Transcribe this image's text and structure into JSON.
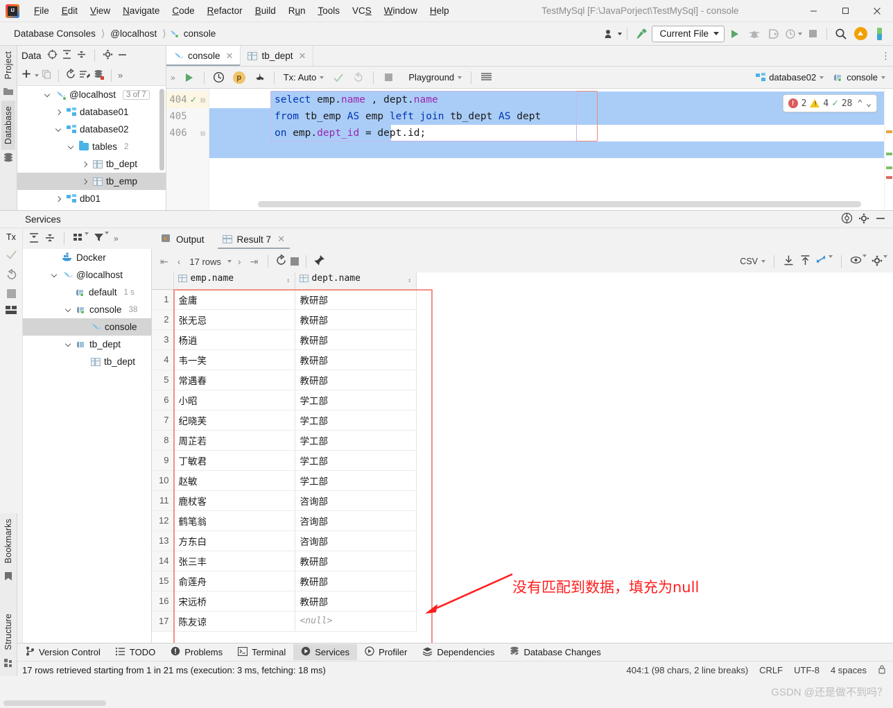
{
  "window": {
    "title": "TestMySql [F:\\JavaPorject\\TestMySql] - console",
    "logo_icon": "intellij-idea-logo",
    "minimize_label": "—",
    "maximize_label": "☐",
    "close_label": "✕"
  },
  "menu": [
    {
      "label": "File",
      "mnemonic": "F"
    },
    {
      "label": "Edit",
      "mnemonic": "E"
    },
    {
      "label": "View",
      "mnemonic": "V"
    },
    {
      "label": "Navigate",
      "mnemonic": "N"
    },
    {
      "label": "Code",
      "mnemonic": "C"
    },
    {
      "label": "Refactor",
      "mnemonic": "R"
    },
    {
      "label": "Build",
      "mnemonic": "B"
    },
    {
      "label": "Run",
      "mnemonic": "u"
    },
    {
      "label": "Tools",
      "mnemonic": "T"
    },
    {
      "label": "VCS",
      "mnemonic": "S"
    },
    {
      "label": "Window",
      "mnemonic": "W"
    },
    {
      "label": "Help",
      "mnemonic": "H"
    }
  ],
  "breadcrumb": {
    "items": [
      "Database Consoles",
      "@localhost",
      "console"
    ],
    "console_icon": "dolphin-icon"
  },
  "navbar": {
    "run_config": "Current File",
    "icons": [
      "settings-sync-icon",
      "build-hammer-icon",
      "run-icon",
      "debug-icon",
      "run-coverage-icon",
      "profile-icon",
      "stop-icon",
      "search-everywhere-icon",
      "update-project-icon"
    ]
  },
  "left_strip": {
    "tabs": [
      "Project",
      "Database",
      "Bookmarks",
      "Structure"
    ]
  },
  "database_panel": {
    "title": "Data",
    "header_icons": [
      "locate-icon",
      "expand-all-icon",
      "collapse-all-icon",
      "settings-icon",
      "hide-icon"
    ],
    "toolbar_icons": [
      "add-icon",
      "copy-icon",
      "refresh-icon",
      "sql-script-icon",
      "db-properties-icon",
      "more-icon"
    ],
    "tree": [
      {
        "label": "@localhost",
        "badge": "3 of 7",
        "icon": "dolphin-icon",
        "expanded": true,
        "indent": 0
      },
      {
        "label": "database01",
        "icon": "schema-icon",
        "expanded": false,
        "indent": 1
      },
      {
        "label": "database02",
        "icon": "schema-icon",
        "expanded": true,
        "indent": 1
      },
      {
        "label": "tables",
        "count": "2",
        "icon": "folder-icon",
        "expanded": true,
        "indent": 2
      },
      {
        "label": "tb_dept",
        "icon": "table-icon",
        "expanded": false,
        "indent": 3
      },
      {
        "label": "tb_emp",
        "icon": "table-icon",
        "expanded": false,
        "indent": 3,
        "selected": true
      },
      {
        "label": "db01",
        "icon": "schema-icon",
        "expanded": false,
        "indent": 1
      }
    ]
  },
  "editor": {
    "tabs": [
      {
        "label": "console",
        "icon": "dolphin-icon",
        "active": true,
        "close": "✕"
      },
      {
        "label": "tb_dept",
        "icon": "table-icon",
        "active": false,
        "close": "✕"
      }
    ],
    "toolbar": {
      "tx_label": "Tx: Auto",
      "schema_label": "Playground",
      "icons": [
        "execute-icon",
        "history-icon",
        "parameters-icon",
        "wrench-icon",
        "commit-icon",
        "rollback-icon",
        "stop-icon",
        "table-mode-icon"
      ]
    },
    "source": {
      "datasource": "database02",
      "datasource_icon": "schema-icon",
      "session": "console",
      "session_icon": "session-icon"
    },
    "lines": [
      {
        "number": "404",
        "gutter_icon": "check-green",
        "tokens": [
          {
            "t": "select ",
            "c": "kw"
          },
          {
            "t": "emp.",
            "c": "pl"
          },
          {
            "t": "name",
            "c": "prop"
          },
          {
            "t": " , dept.",
            "c": "pl"
          },
          {
            "t": "name",
            "c": "prop"
          }
        ]
      },
      {
        "number": "405",
        "tokens": [
          {
            "t": "from ",
            "c": "kw"
          },
          {
            "t": "tb_emp ",
            "c": "pl"
          },
          {
            "t": "AS ",
            "c": "kw"
          },
          {
            "t": "emp ",
            "c": "pl"
          },
          {
            "t": "left join ",
            "c": "kw"
          },
          {
            "t": "tb_dept ",
            "c": "pl"
          },
          {
            "t": "AS ",
            "c": "kw"
          },
          {
            "t": "dept",
            "c": "pl"
          }
        ]
      },
      {
        "number": "406",
        "tokens": [
          {
            "t": "on ",
            "c": "kw"
          },
          {
            "t": "emp.",
            "c": "pl"
          },
          {
            "t": "dept_id",
            "c": "prop"
          },
          {
            "t": " = dept.",
            "c": "pl"
          },
          {
            "t": "id;",
            "c": "pl"
          }
        ]
      }
    ],
    "plain_lines": [
      "select emp.name , dept.name",
      "from tb_emp AS emp left join tb_dept AS dept",
      "on emp.dept_id = dept.id;"
    ],
    "inspection": {
      "errors": "2",
      "warnings": "4",
      "typos": "28",
      "up_label": "⌃",
      "down_label": "⌄"
    }
  },
  "services": {
    "title": "Services",
    "header_icons": [
      "help-icon",
      "settings-icon",
      "hide-icon"
    ],
    "vtool": {
      "label": "Tx",
      "icons": [
        "commit-icon",
        "rollback-icon",
        "stop-icon",
        "layout-icon"
      ]
    },
    "tree_toolbar_icons": [
      "expand-all-icon",
      "collapse-all-icon",
      "group-icon",
      "filter-icon",
      "more-icon"
    ],
    "tree": [
      {
        "label": "Docker",
        "icon": "docker-icon",
        "indent": 1,
        "expanded": null
      },
      {
        "label": "@localhost",
        "icon": "dolphin-icon",
        "indent": 1,
        "expanded": true
      },
      {
        "label": "default",
        "suffix": "1 s",
        "icon": "session-icon",
        "indent": 2
      },
      {
        "label": "console",
        "suffix": "38",
        "icon": "session-icon",
        "indent": 2,
        "expanded": true
      },
      {
        "label": "console",
        "icon": "dolphin-icon",
        "indent": 3,
        "selected": true
      },
      {
        "label": "tb_dept",
        "icon": "session-icon",
        "indent": 2,
        "expanded": true
      },
      {
        "label": "tb_dept",
        "icon": "table-icon",
        "indent": 3
      }
    ],
    "result_tabs": [
      {
        "label": "Output",
        "icon": "output-icon",
        "active": false
      },
      {
        "label": "Result 7",
        "icon": "table-icon",
        "active": true,
        "close": "✕"
      }
    ],
    "result_toolbar": {
      "rows_label": "17 rows",
      "format": "CSV",
      "icons": [
        "first-page-icon",
        "prev-page-icon",
        "next-page-icon",
        "last-page-icon",
        "reload-icon",
        "stop-icon",
        "pin-icon",
        "download-icon",
        "upload-icon",
        "transpose-icon",
        "view-options-icon",
        "settings-icon"
      ]
    }
  },
  "result_grid": {
    "columns": [
      "emp.name",
      "dept.name"
    ],
    "column_icon": "column-icon",
    "rows": [
      {
        "n": "1",
        "emp_name": "金庸",
        "dept_name": "教研部"
      },
      {
        "n": "2",
        "emp_name": "张无忌",
        "dept_name": "教研部"
      },
      {
        "n": "3",
        "emp_name": "杨逍",
        "dept_name": "教研部"
      },
      {
        "n": "4",
        "emp_name": "韦一笑",
        "dept_name": "教研部"
      },
      {
        "n": "5",
        "emp_name": "常遇春",
        "dept_name": "教研部"
      },
      {
        "n": "6",
        "emp_name": "小昭",
        "dept_name": "学工部"
      },
      {
        "n": "7",
        "emp_name": "纪晓芙",
        "dept_name": "学工部"
      },
      {
        "n": "8",
        "emp_name": "周芷若",
        "dept_name": "学工部"
      },
      {
        "n": "9",
        "emp_name": "丁敏君",
        "dept_name": "学工部"
      },
      {
        "n": "10",
        "emp_name": "赵敏",
        "dept_name": "学工部"
      },
      {
        "n": "11",
        "emp_name": "鹿杖客",
        "dept_name": "咨询部"
      },
      {
        "n": "12",
        "emp_name": "鹤笔翁",
        "dept_name": "咨询部"
      },
      {
        "n": "13",
        "emp_name": "方东白",
        "dept_name": "咨询部"
      },
      {
        "n": "14",
        "emp_name": "张三丰",
        "dept_name": "教研部"
      },
      {
        "n": "15",
        "emp_name": "俞莲舟",
        "dept_name": "教研部"
      },
      {
        "n": "16",
        "emp_name": "宋远桥",
        "dept_name": "教研部"
      },
      {
        "n": "17",
        "emp_name": "陈友谅",
        "dept_name": "<null>",
        "dept_is_null": true
      }
    ]
  },
  "annotation": {
    "text": "没有匹配到数据，填充为null",
    "color": "#ff1e1e"
  },
  "bottom_tabs": [
    {
      "label": "Version Control",
      "icon": "branch-icon",
      "active": false
    },
    {
      "label": "TODO",
      "icon": "todo-icon",
      "active": false
    },
    {
      "label": "Problems",
      "icon": "problems-icon",
      "active": false
    },
    {
      "label": "Terminal",
      "icon": "terminal-icon",
      "active": false
    },
    {
      "label": "Services",
      "icon": "services-icon",
      "active": true
    },
    {
      "label": "Profiler",
      "icon": "profiler-icon",
      "active": false
    },
    {
      "label": "Dependencies",
      "icon": "dependencies-icon",
      "active": false
    },
    {
      "label": "Database Changes",
      "icon": "database-changes-icon",
      "active": false
    }
  ],
  "status_bar": {
    "icon": "console-icon",
    "message": "17 rows retrieved starting from 1 in 21 ms (execution: 3 ms, fetching: 18 ms)",
    "caret": "404:1 (98 chars, 2 line breaks)",
    "line_sep": "CRLF",
    "encoding": "UTF-8",
    "indent": "4 spaces"
  },
  "watermark": "GSDN @还是做不到吗？"
}
